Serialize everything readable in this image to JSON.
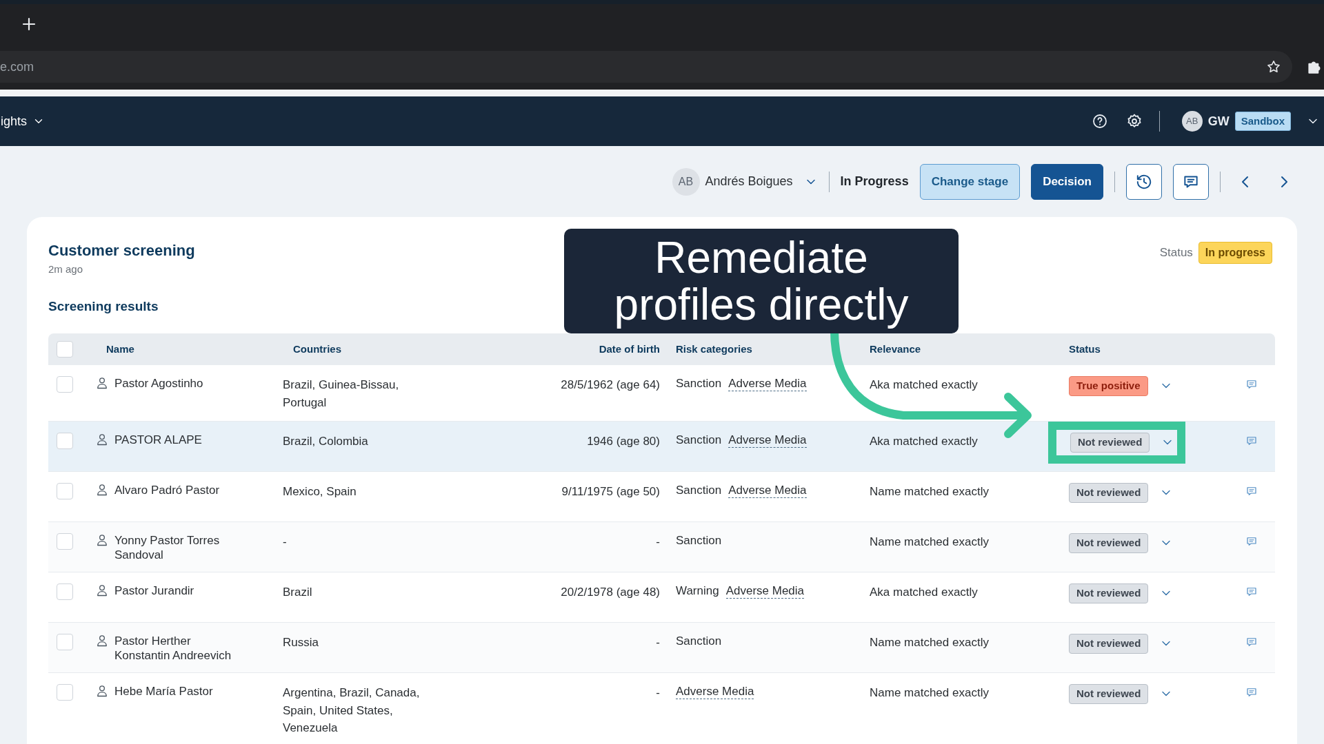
{
  "browser": {
    "address": "e.com"
  },
  "app_nav": {
    "menu_label": "ights",
    "user_initials": "AB",
    "user_name": "GW",
    "environment": "Sandbox"
  },
  "toolbar": {
    "assignee_initials": "AB",
    "assignee": "Andrés Boigues",
    "stage": "In Progress",
    "buttons": [
      {
        "label": "Change stage",
        "kind": "secondary"
      },
      {
        "label": "Decision",
        "kind": "primary"
      }
    ]
  },
  "card": {
    "title": "Customer screening",
    "time": "2m ago",
    "status_label": "Status",
    "status": "In progress",
    "section": "Screening results"
  },
  "overlay": {
    "caption": "Remediate profiles directly"
  },
  "table": {
    "select_all": {
      "checked": false
    },
    "columns": [
      "Name",
      "Countries",
      "Date of birth",
      "Risk categories",
      "Relevance",
      "Status"
    ],
    "rows": [
      {
        "checked": false,
        "highlighted": false,
        "name": "Pastor Agostinho",
        "countries": "Brazil, Guinea-Bissau, Portugal",
        "dob": "28/5/1962 (age 64)",
        "risks": [
          {
            "label": "Sanction",
            "kind": "plain"
          },
          {
            "label": "Adverse Media",
            "kind": "link"
          }
        ],
        "relevance": "Aka matched exactly",
        "status": {
          "label": "True positive",
          "kind": "true_positive",
          "callout": false
        }
      },
      {
        "checked": false,
        "highlighted": true,
        "name": "PASTOR ALAPE",
        "countries": "Brazil, Colombia",
        "dob": "1946 (age 80)",
        "risks": [
          {
            "label": "Sanction",
            "kind": "plain"
          },
          {
            "label": "Adverse Media",
            "kind": "link"
          }
        ],
        "relevance": "Aka matched exactly",
        "status": {
          "label": "Not reviewed",
          "kind": "not_reviewed",
          "callout": true
        }
      },
      {
        "checked": false,
        "highlighted": false,
        "name": "Alvaro Padró Pastor",
        "countries": "Mexico, Spain",
        "dob": "9/11/1975 (age 50)",
        "risks": [
          {
            "label": "Sanction",
            "kind": "plain"
          },
          {
            "label": "Adverse Media",
            "kind": "link"
          }
        ],
        "relevance": "Name matched exactly",
        "status": {
          "label": "Not reviewed",
          "kind": "not_reviewed",
          "callout": false
        }
      },
      {
        "checked": false,
        "highlighted": false,
        "name": "Yonny Pastor Torres Sandoval",
        "countries": "-",
        "dob": "-",
        "risks": [
          {
            "label": "Sanction",
            "kind": "plain"
          }
        ],
        "relevance": "Name matched exactly",
        "status": {
          "label": "Not reviewed",
          "kind": "not_reviewed",
          "callout": false
        }
      },
      {
        "checked": false,
        "highlighted": false,
        "name": "Pastor Jurandir",
        "countries": "Brazil",
        "dob": "20/2/1978 (age 48)",
        "risks": [
          {
            "label": "Warning",
            "kind": "plain"
          },
          {
            "label": "Adverse Media",
            "kind": "link"
          }
        ],
        "relevance": "Aka matched exactly",
        "status": {
          "label": "Not reviewed",
          "kind": "not_reviewed",
          "callout": false
        }
      },
      {
        "checked": false,
        "highlighted": false,
        "name": "Pastor Herther Konstantin Andreevich",
        "countries": "Russia",
        "dob": "-",
        "risks": [
          {
            "label": "Sanction",
            "kind": "plain"
          }
        ],
        "relevance": "Name matched exactly",
        "status": {
          "label": "Not reviewed",
          "kind": "not_reviewed",
          "callout": false
        }
      },
      {
        "checked": false,
        "highlighted": false,
        "name": "Hebe María Pastor",
        "countries": "Argentina, Brazil, Canada, Spain, United States, Venezuela",
        "dob": "-",
        "risks": [
          {
            "label": "Adverse Media",
            "kind": "link"
          }
        ],
        "relevance": "Name matched exactly",
        "status": {
          "label": "Not reviewed",
          "kind": "not_reviewed",
          "callout": false
        }
      }
    ]
  }
}
